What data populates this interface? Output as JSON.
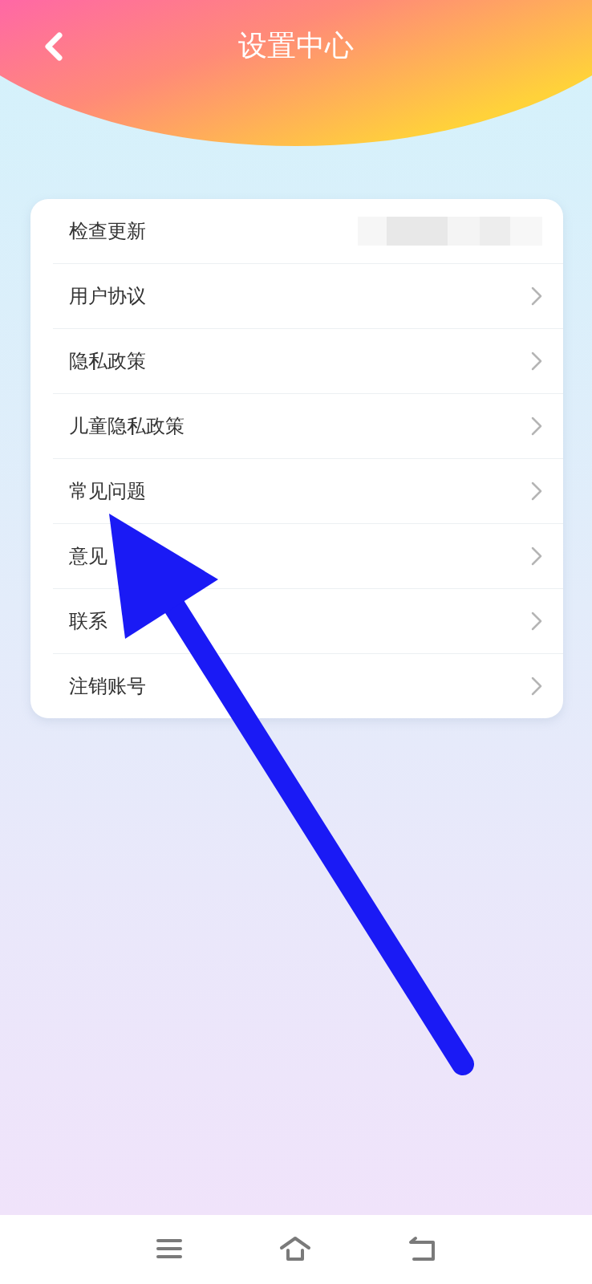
{
  "header": {
    "title": "设置中心"
  },
  "menu": [
    {
      "label": "检查更新",
      "kind": "blurred"
    },
    {
      "label": "用户协议",
      "kind": "link"
    },
    {
      "label": "隐私政策",
      "kind": "link"
    },
    {
      "label": "儿童隐私政策",
      "kind": "link"
    },
    {
      "label": "常见问题",
      "kind": "link"
    },
    {
      "label": "意见",
      "kind": "link"
    },
    {
      "label": "联系",
      "kind": "link"
    },
    {
      "label": "注销账号",
      "kind": "link"
    }
  ],
  "nav_bar": [
    {
      "kind": "menu"
    },
    {
      "kind": "home"
    },
    {
      "kind": "back"
    }
  ]
}
